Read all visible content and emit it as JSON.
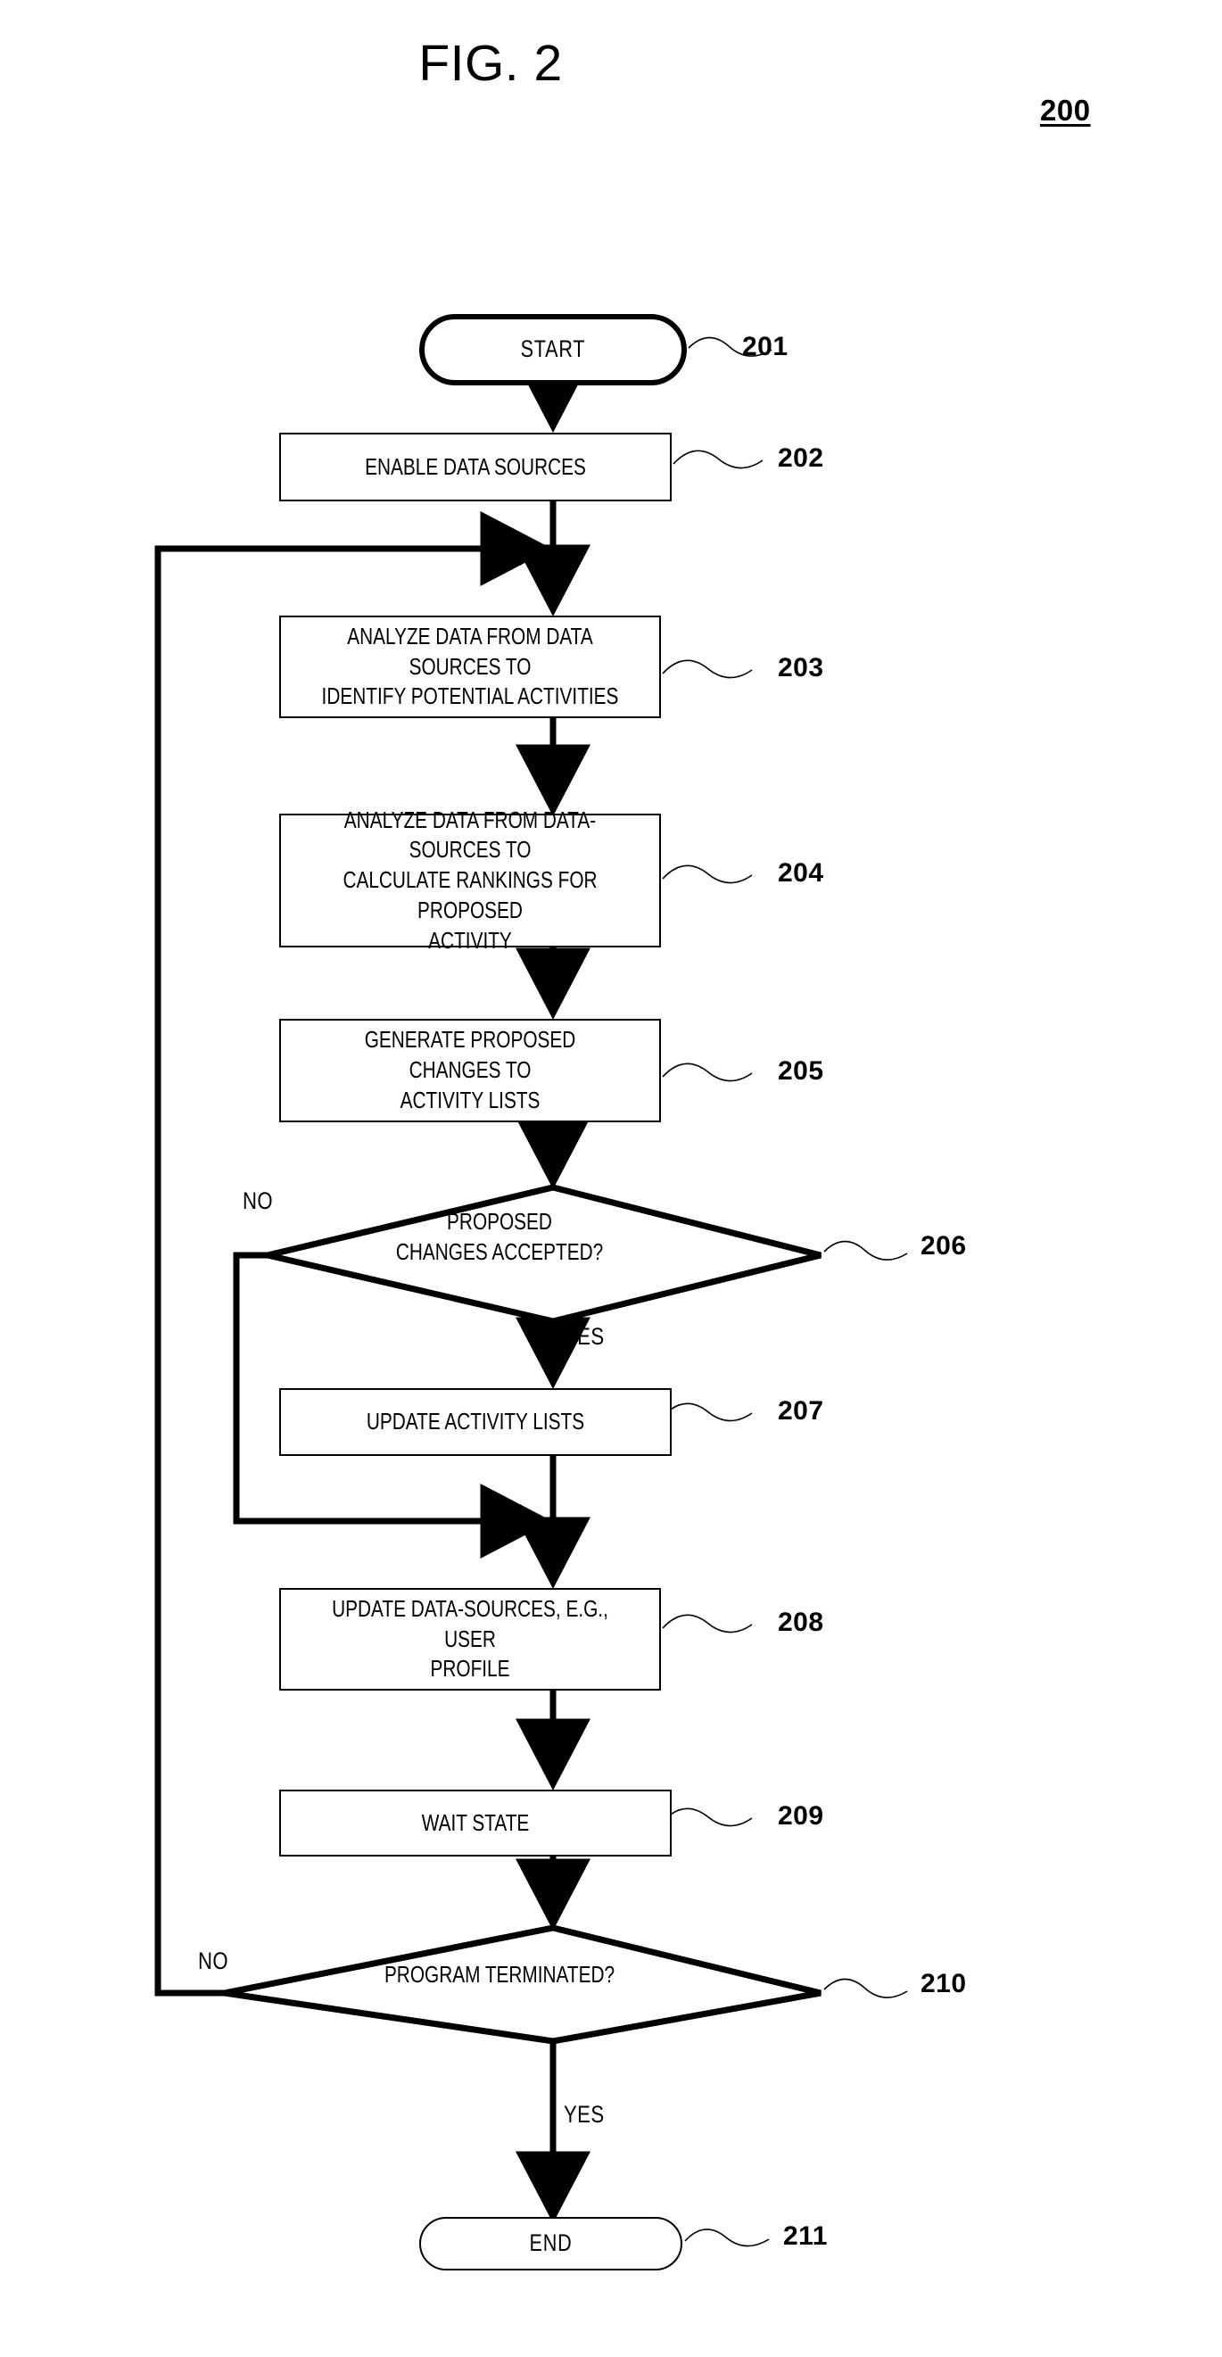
{
  "figure": {
    "title": "FIG. 2",
    "ref_number": "200"
  },
  "nodes": [
    {
      "id": "201",
      "type": "terminator",
      "label": "START",
      "ref": "201"
    },
    {
      "id": "202",
      "type": "process",
      "label": "ENABLE DATA SOURCES",
      "ref": "202"
    },
    {
      "id": "203",
      "type": "process",
      "label": "ANALYZE DATA FROM DATA SOURCES TO\nIDENTIFY POTENTIAL ACTIVITIES",
      "ref": "203"
    },
    {
      "id": "204",
      "type": "process",
      "label": "ANALYZE DATA FROM DATA-SOURCES TO\nCALCULATE RANKINGS FOR PROPOSED\nACTIVITY",
      "ref": "204"
    },
    {
      "id": "205",
      "type": "process",
      "label": "GENERATE PROPOSED CHANGES TO\nACTIVITY LISTS",
      "ref": "205"
    },
    {
      "id": "206",
      "type": "decision",
      "label": "PROPOSED\nCHANGES ACCEPTED?",
      "ref": "206"
    },
    {
      "id": "207",
      "type": "process",
      "label": "UPDATE ACTIVITY LISTS",
      "ref": "207"
    },
    {
      "id": "208",
      "type": "process",
      "label": "UPDATE DATA-SOURCES, E.G., USER\nPROFILE",
      "ref": "208"
    },
    {
      "id": "209",
      "type": "process",
      "label": "WAIT STATE",
      "ref": "209"
    },
    {
      "id": "210",
      "type": "decision",
      "label": "PROGRAM TERMINATED?",
      "ref": "210"
    },
    {
      "id": "211",
      "type": "terminator",
      "label": "END",
      "ref": "211"
    }
  ],
  "branches": {
    "d206_no": "NO",
    "d206_yes": "YES",
    "d210_no": "NO",
    "d210_yes": "YES"
  },
  "refs": {
    "r201": "201",
    "r202": "202",
    "r203": "203",
    "r204": "204",
    "r205": "205",
    "r206": "206",
    "r207": "207",
    "r208": "208",
    "r209": "209",
    "r210": "210",
    "r211": "211"
  },
  "colors": {
    "ink": "#000000",
    "paper": "#ffffff"
  }
}
